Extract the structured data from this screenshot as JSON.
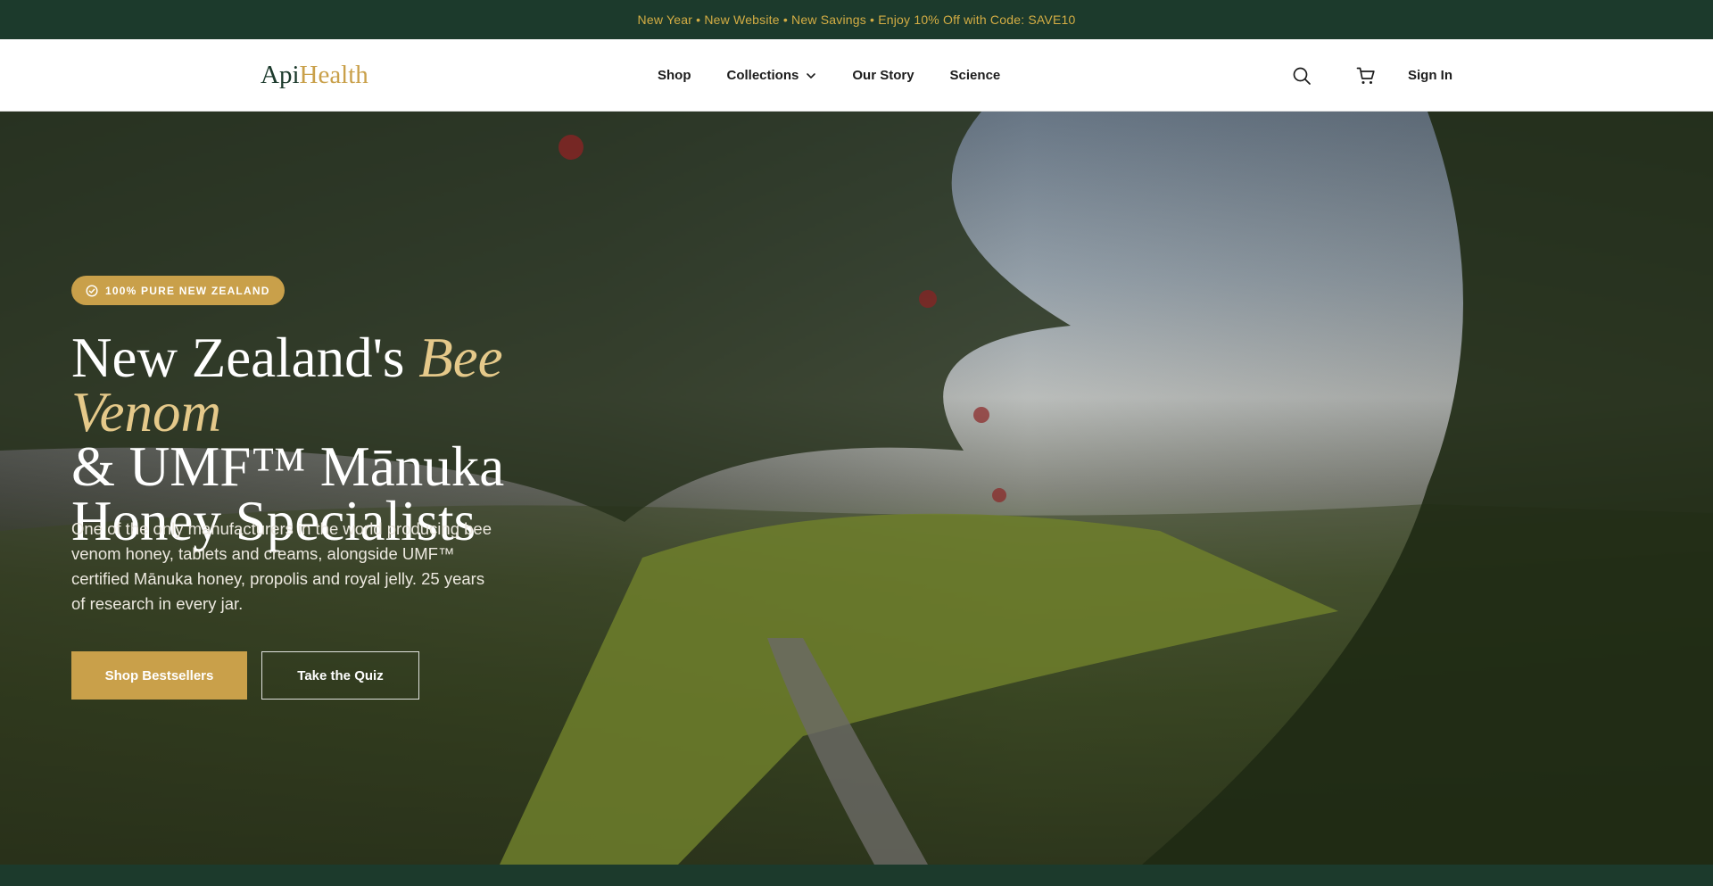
{
  "announcement": {
    "text": "New Year • New Website • New Savings • Enjoy 10% Off with Code: SAVE10"
  },
  "brand": {
    "part1": "Api",
    "part2": "Health",
    "colors": {
      "primary": "#1c3a2c",
      "accent": "#c9a04a",
      "accent_light": "#e5c98a"
    }
  },
  "nav": {
    "items": [
      {
        "label": "Shop"
      },
      {
        "label": "Collections",
        "icon": "chevron-down-icon"
      },
      {
        "label": "Our Story"
      },
      {
        "label": "Science"
      }
    ],
    "search_icon": "search-icon",
    "cart_icon": "cart-icon",
    "sign_in": "Sign In"
  },
  "hero": {
    "badge": "100% PURE NEW ZEALAND",
    "badge_icon": "check-circle-icon",
    "headline_part1": "New Zealand's ",
    "headline_accent": "Bee Venom",
    "headline_part2": "& UMF™ Mānuka Honey Specialists",
    "subcopy": "One of the only manufacturers in the world producing bee venom honey, tablets and creams, alongside UMF™ certified Mānuka honey, propolis and royal jelly. 25 years of research in every jar.",
    "cta_primary": "Shop Bestsellers",
    "cta_secondary": "Take the Quiz"
  }
}
